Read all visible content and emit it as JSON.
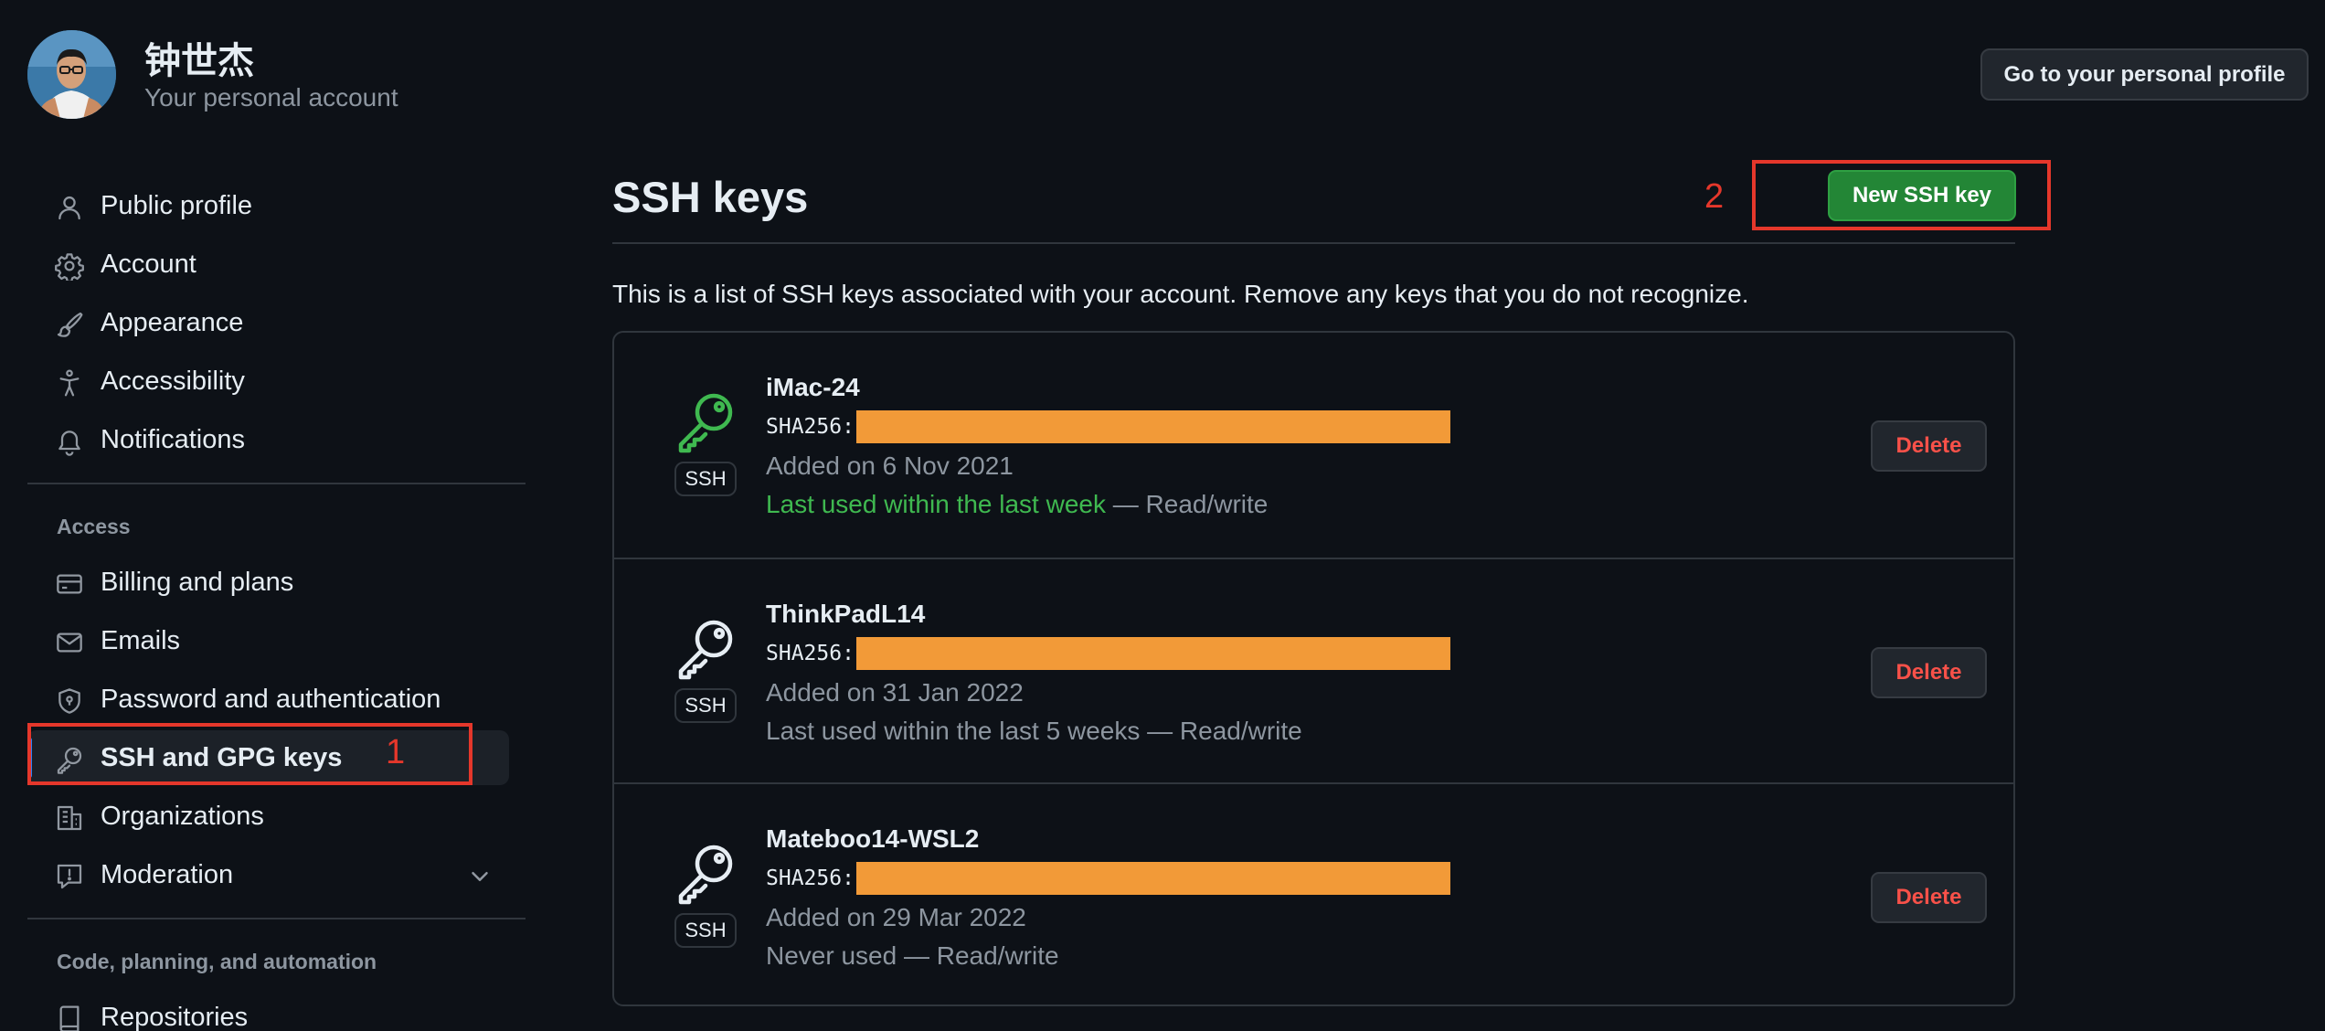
{
  "header": {
    "user_name": "钟世杰",
    "user_subtitle": "Your personal account",
    "profile_button": "Go to your personal profile"
  },
  "sidebar": {
    "items": [
      {
        "label": "Public profile",
        "icon": "person-icon"
      },
      {
        "label": "Account",
        "icon": "gear-icon"
      },
      {
        "label": "Appearance",
        "icon": "paintbrush-icon"
      },
      {
        "label": "Accessibility",
        "icon": "accessibility-icon"
      },
      {
        "label": "Notifications",
        "icon": "bell-icon"
      }
    ],
    "access_title": "Access",
    "access_items": [
      {
        "label": "Billing and plans",
        "icon": "credit-card-icon"
      },
      {
        "label": "Emails",
        "icon": "mail-icon"
      },
      {
        "label": "Password and authentication",
        "icon": "shield-lock-icon"
      },
      {
        "label": "SSH and GPG keys",
        "icon": "key-icon",
        "active": true
      },
      {
        "label": "Organizations",
        "icon": "organization-icon"
      },
      {
        "label": "Moderation",
        "icon": "report-icon",
        "expandable": true
      }
    ],
    "code_title": "Code, planning, and automation",
    "code_items": [
      {
        "label": "Repositories",
        "icon": "repo-icon"
      }
    ]
  },
  "main": {
    "title": "SSH keys",
    "new_key_button": "New SSH key",
    "description": "This is a list of SSH keys associated with your account. Remove any keys that you do not recognize.",
    "badge": "SSH",
    "fingerprint_prefix": "SHA256:",
    "delete_label": "Delete",
    "keys": [
      {
        "name": "iMac-24",
        "added": "Added on 6 Nov 2021",
        "last_used_recent": "Last used within the last week",
        "access": " — Read/write"
      },
      {
        "name": "ThinkPadL14",
        "added": "Added on 31 Jan 2022",
        "last_used": "Last used within the last 5 weeks — Read/write"
      },
      {
        "name": "Mateboo14-WSL2",
        "added": "Added on 29 Mar 2022",
        "last_used": "Never used — Read/write"
      }
    ]
  },
  "annotations": {
    "marker_1": "1",
    "marker_2": "2"
  },
  "colors": {
    "background": "#0d1117",
    "accent_green": "#238636",
    "recent_green": "#3fb950",
    "danger": "#f85149",
    "redaction": "#f29a38",
    "annotation": "#e5372b"
  }
}
